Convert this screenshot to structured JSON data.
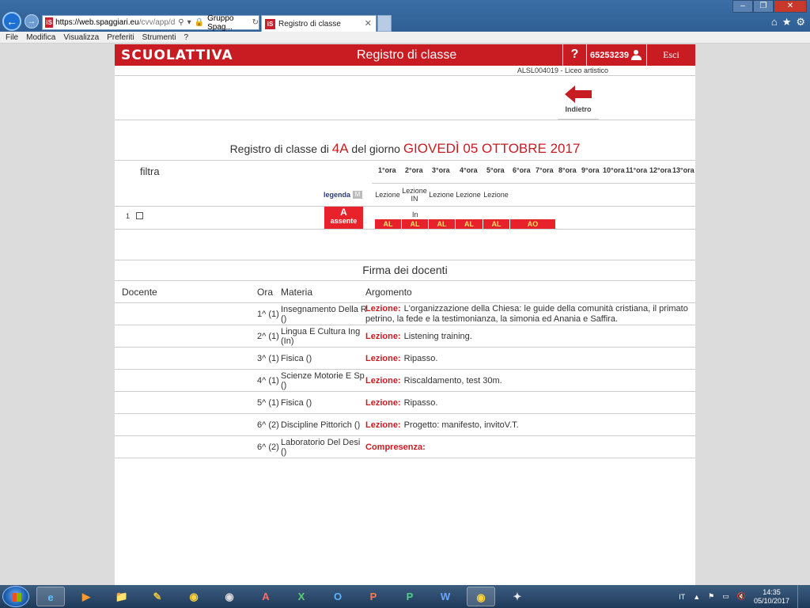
{
  "browser": {
    "url_main": "https://web.spaggiari.eu",
    "url_rest": "/cvv/app/d",
    "site_identity": "Gruppo Spag...",
    "tab_title": "Registro di classe",
    "tab_close": "✕",
    "menu": [
      "File",
      "Modifica",
      "Visualizza",
      "Preferiti",
      "Strumenti",
      "?"
    ]
  },
  "header": {
    "logo": "SCUOLATTIVA",
    "title": "Registro di classe",
    "help": "?",
    "user_code": "65253239",
    "logout": "Esci"
  },
  "school_info": "ALSL004019 - Liceo artistico",
  "back": {
    "label": "Indietro"
  },
  "register": {
    "title_prefix": "Registro di classe di",
    "class": "4A",
    "title_middle": "del giorno",
    "date": "GIOVEDÌ 05 OTTOBRE 2017"
  },
  "filter": {
    "label": "filtra"
  },
  "hours": [
    "1°ora",
    "2°ora",
    "3°ora",
    "4°ora",
    "5°ora",
    "6°ora",
    "7°ora",
    "8°ora",
    "9°ora",
    "10°ora",
    "11°ora",
    "12°ora",
    "13°ora"
  ],
  "legenda": {
    "label": "legenda",
    "badge": "M"
  },
  "lesson_types": [
    "Lezione",
    "Lezione IN",
    "Lezione",
    "Lezione",
    "Lezione"
  ],
  "student": {
    "number": "1",
    "status_letter": "A",
    "status_text": "assente",
    "in_mark": "In",
    "attendance": [
      "AL",
      "AL",
      "AL",
      "AL",
      "AL",
      "AO"
    ]
  },
  "signatures": {
    "title": "Firma dei docenti",
    "headers": {
      "docente": "Docente",
      "ora": "Ora",
      "materia": "Materia",
      "argomento": "Argomento"
    },
    "rows": [
      {
        "ora": "1^ (1)",
        "materia": "Insegnamento Della R  ()",
        "tipo": "Lezione:",
        "argomento": "L'organizzazione della Chiesa: le guide della comunità cristiana, il primato petrino, la fede e la testimonianza, la simonia ed Anania e Saffira."
      },
      {
        "ora": "2^ (1)",
        "materia": "Lingua E Cultura Ing  (In)",
        "tipo": "Lezione:",
        "argomento": "Listening training."
      },
      {
        "ora": "3^ (1)",
        "materia": "Fisica  ()",
        "tipo": "Lezione:",
        "argomento": "Ripasso."
      },
      {
        "ora": "4^ (1)",
        "materia": "Scienze Motorie E Sp  ()",
        "tipo": "Lezione:",
        "argomento": "Riscaldamento, test 30m."
      },
      {
        "ora": "5^ (1)",
        "materia": "Fisica  ()",
        "tipo": "Lezione:",
        "argomento": "Ripasso."
      },
      {
        "ora": "6^ (2)",
        "materia": "Discipline Pittorich ()",
        "tipo": "Lezione:",
        "argomento": "Progetto: manifesto, invitoV.T."
      },
      {
        "ora": "6^ (2)",
        "materia": "Laboratorio Del Desi  ()",
        "tipo": "Compresenza:",
        "argomento": ""
      }
    ]
  },
  "taskbar": {
    "language": "IT",
    "time": "14:35",
    "date": "05/10/2017"
  },
  "colors": {
    "brand_red": "#c91c22",
    "absent_red": "#e8222a",
    "attendance_text": "#ffdc6a"
  }
}
